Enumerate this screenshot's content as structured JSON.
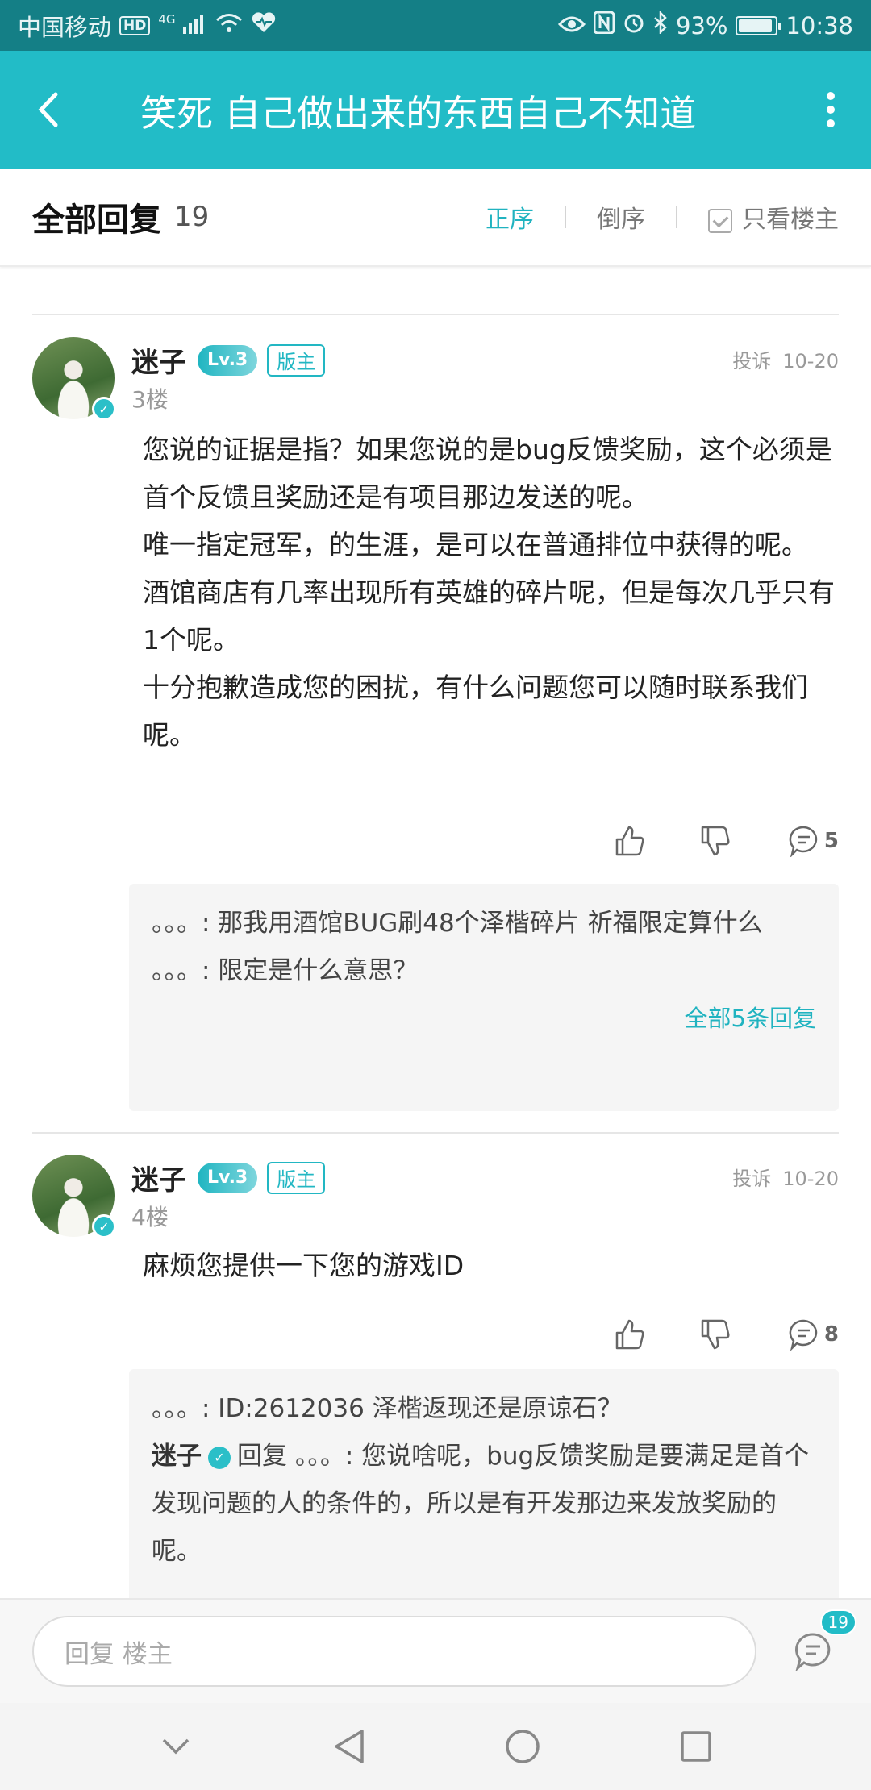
{
  "status_bar": {
    "carrier": "中国移动",
    "hd": "HD",
    "network": "4G",
    "battery_percent": "93%",
    "battery_level": 0.93,
    "time": "10:38"
  },
  "header": {
    "title": "笑死  自己做出来的东西自己不知道"
  },
  "sort_bar": {
    "label": "全部回复",
    "count": "19",
    "asc": "正序",
    "desc": "倒序",
    "op_only": "只看楼主"
  },
  "posts": [
    {
      "username": "迷子",
      "level": "Lv.3",
      "role": "版主",
      "report": "投诉",
      "date": "10-20",
      "floor": "3楼",
      "content": [
        "您说的证据是指？如果您说的是bug反馈奖励，这个必须是首个反馈且奖励还是有项目那边发送的呢。",
        "唯一指定冠军，的生涯，是可以在普通排位中获得的呢。",
        "酒馆商店有几率出现所有英雄的碎片呢，但是每次几乎只有1个呢。",
        "十分抱歉造成您的困扰，有什么问题您可以随时联系我们呢。"
      ],
      "comment_count": "5",
      "replies": [
        {
          "name": "。。。",
          "text": ": 那我用酒馆BUG刷48个泽楷碎片   祈福限定算什么"
        },
        {
          "name": "。。。",
          "text": ": 限定是什么意思？"
        }
      ],
      "more_replies": "全部5条回复"
    },
    {
      "username": "迷子",
      "level": "Lv.3",
      "role": "版主",
      "report": "投诉",
      "date": "10-20",
      "floor": "4楼",
      "content": [
        "麻烦您提供一下您的游戏ID"
      ],
      "comment_count": "8",
      "replies": [
        {
          "name": "。。。",
          "text": ": ID:2612036   泽楷返现还是原谅石？"
        },
        {
          "name": "迷子",
          "reply_word": "回复",
          "target": "。。。",
          "text": ": 您说啥呢，bug反馈奖励是要满足是首个发现问题的人的条件的，所以是有开发那边来发放奖励的呢。"
        }
      ]
    }
  ],
  "input_bar": {
    "placeholder": "回复  楼主",
    "badge": "19"
  }
}
